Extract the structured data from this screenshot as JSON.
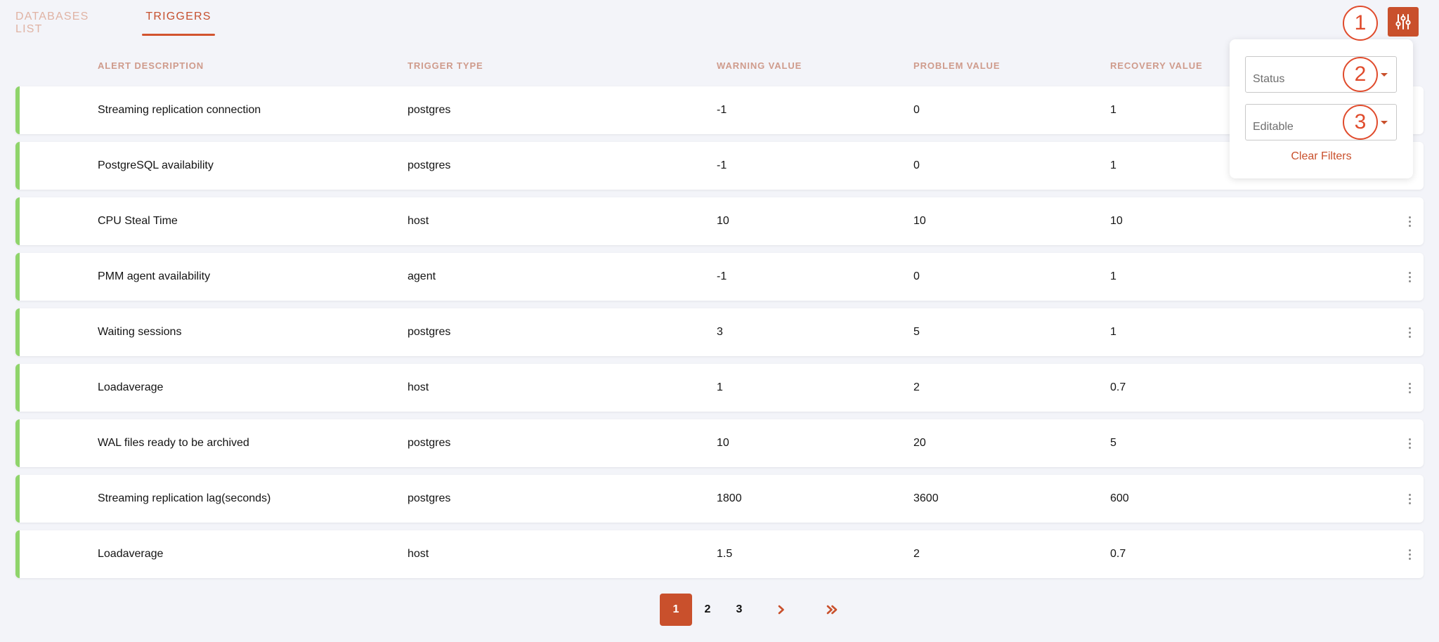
{
  "tabs": [
    {
      "label": "DATABASES LIST",
      "active": false
    },
    {
      "label": "TRIGGERS",
      "active": true
    }
  ],
  "columns": {
    "alert_description": "ALERT DESCRIPTION",
    "trigger_type": "TRIGGER TYPE",
    "warning_value": "WARNING VALUE",
    "problem_value": "PROBLEM VALUE",
    "recovery_value": "RECOVERY VALUE"
  },
  "rows": [
    {
      "description": "Streaming replication connection",
      "type": "postgres",
      "warning": "-1",
      "problem": "0",
      "recovery": "1"
    },
    {
      "description": "PostgreSQL availability",
      "type": "postgres",
      "warning": "-1",
      "problem": "0",
      "recovery": "1"
    },
    {
      "description": "CPU Steal Time",
      "type": "host",
      "warning": "10",
      "problem": "10",
      "recovery": "10"
    },
    {
      "description": "PMM agent availability",
      "type": "agent",
      "warning": "-1",
      "problem": "0",
      "recovery": "1"
    },
    {
      "description": "Waiting sessions",
      "type": "postgres",
      "warning": "3",
      "problem": "5",
      "recovery": "1"
    },
    {
      "description": "Loadaverage",
      "type": "host",
      "warning": "1",
      "problem": "2",
      "recovery": "0.7"
    },
    {
      "description": "WAL files ready to be archived",
      "type": "postgres",
      "warning": "10",
      "problem": "20",
      "recovery": "5"
    },
    {
      "description": "Streaming replication lag(seconds)",
      "type": "postgres",
      "warning": "1800",
      "problem": "3600",
      "recovery": "600"
    },
    {
      "description": "Loadaverage",
      "type": "host",
      "warning": "1.5",
      "problem": "2",
      "recovery": "0.7"
    }
  ],
  "row_status_color": "#8fd46b",
  "accent_color": "#c9502c",
  "filters": {
    "status_placeholder": "Status",
    "editable_placeholder": "Editable",
    "clear_label": "Clear Filters"
  },
  "pagination": {
    "pages": [
      "1",
      "2",
      "3"
    ],
    "current": "1"
  },
  "icons": {
    "filter_toggle": "sliders-icon",
    "next": "chevron-right-icon",
    "last": "double-chevron-right-icon",
    "row_menu": "kebab-menu-icon"
  },
  "callouts": [
    "1",
    "2",
    "3"
  ]
}
